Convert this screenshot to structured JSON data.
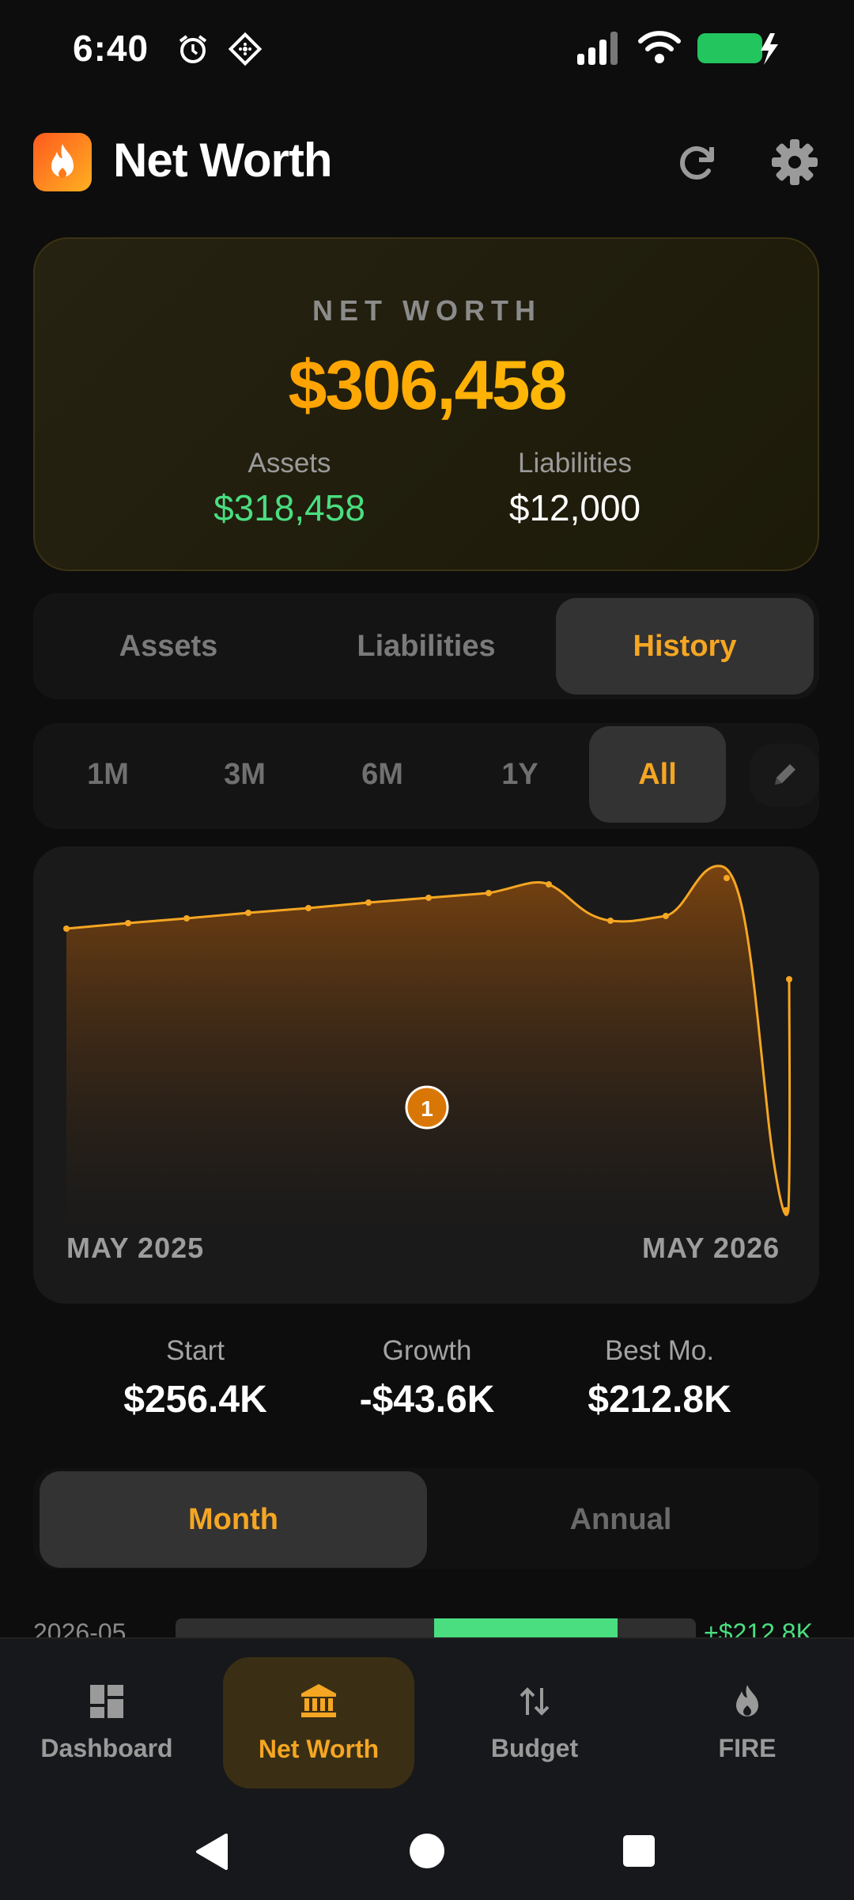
{
  "status_bar": {
    "time": "6:40"
  },
  "header": {
    "title": "Net Worth"
  },
  "summary": {
    "label": "NET WORTH",
    "value": "$306,458",
    "assets_label": "Assets",
    "assets_value": "$318,458",
    "liabilities_label": "Liabilities",
    "liabilities_value": "$12,000"
  },
  "tabs": [
    {
      "label": "Assets",
      "active": false
    },
    {
      "label": "Liabilities",
      "active": false
    },
    {
      "label": "History",
      "active": true
    }
  ],
  "ranges": [
    {
      "label": "1M",
      "active": false
    },
    {
      "label": "3M",
      "active": false
    },
    {
      "label": "6M",
      "active": false
    },
    {
      "label": "1Y",
      "active": false
    },
    {
      "label": "All",
      "active": true
    }
  ],
  "chart_data": {
    "type": "area",
    "x_start_label": "MAY 2025",
    "x_end_label": "MAY 2026",
    "marker_label": "1",
    "color": "#f5a623"
  },
  "stats": [
    {
      "label": "Start",
      "value": "$256.4K"
    },
    {
      "label": "Growth",
      "value": "-$43.6K"
    },
    {
      "label": "Best Mo.",
      "value": "$212.8K"
    }
  ],
  "period_toggle": [
    {
      "label": "Month",
      "active": true
    },
    {
      "label": "Annual",
      "active": false
    }
  ],
  "month_rows": [
    {
      "label": "2026-05",
      "value": "+$212.8K"
    }
  ],
  "nav": [
    {
      "label": "Dashboard",
      "icon": "dashboard-icon",
      "active": false
    },
    {
      "label": "Net Worth",
      "icon": "bank-icon",
      "active": true
    },
    {
      "label": "Budget",
      "icon": "transfer-icon",
      "active": false
    },
    {
      "label": "FIRE",
      "icon": "fire-icon",
      "active": false
    }
  ],
  "colors": {
    "accent": "#f5a623",
    "positive": "#4ade80",
    "background": "#0d0d0d"
  }
}
